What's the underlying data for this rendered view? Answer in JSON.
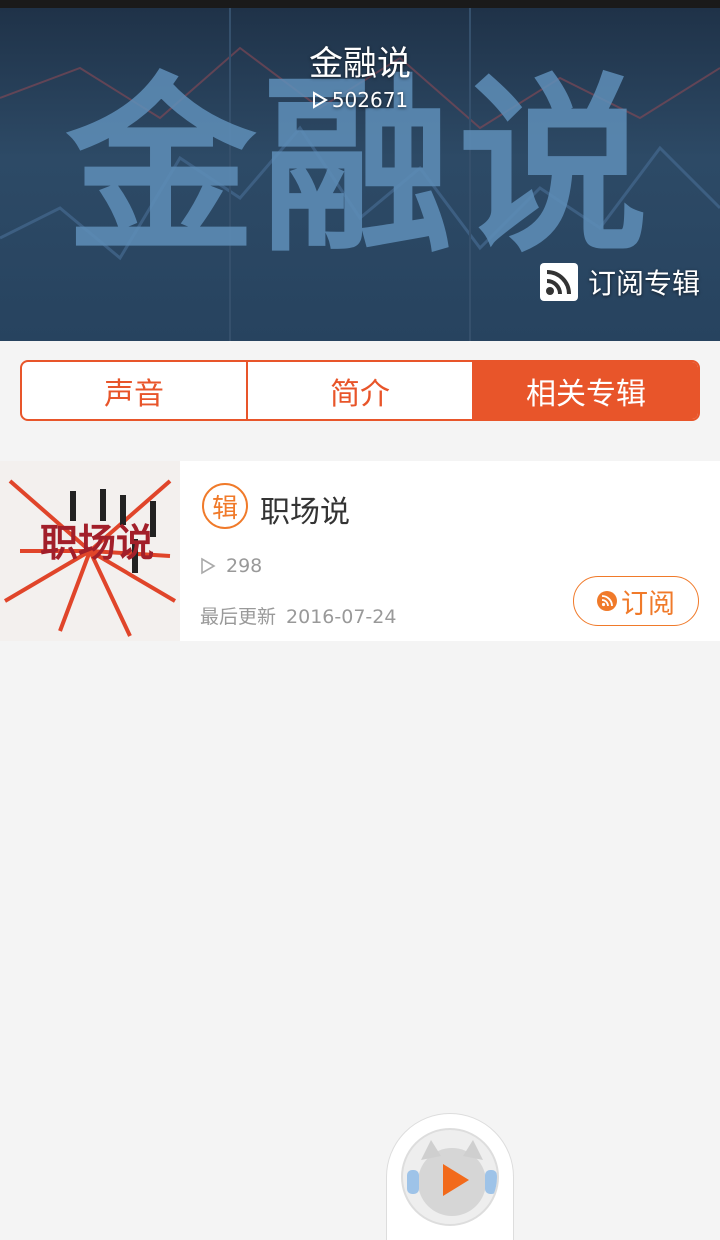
{
  "header": {
    "title": "金融说",
    "plays": "502671",
    "banner_text": "金融说",
    "subscribe_label": "订阅专辑"
  },
  "tabs": [
    {
      "label": "声音",
      "active": false
    },
    {
      "label": "简介",
      "active": false
    },
    {
      "label": "相关专辑",
      "active": true
    }
  ],
  "albums": [
    {
      "badge": "辑",
      "title": "职场说",
      "thumb_text": "职场说",
      "plays": "298",
      "update_label": "最后更新",
      "update_date": "2016-07-24",
      "subscribe_label": "订阅"
    }
  ],
  "colors": {
    "accent": "#e8552a",
    "badge": "#f07a2a",
    "background": "#f4f4f4"
  },
  "icons": [
    "play-icon",
    "rss-icon",
    "player-play-icon"
  ]
}
